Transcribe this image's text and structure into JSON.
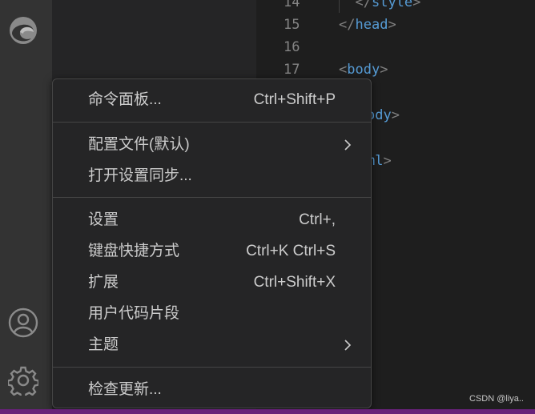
{
  "editor": {
    "lines": [
      {
        "num": "14",
        "indent": "  ",
        "open": "</",
        "tag": "style",
        "close": ">"
      },
      {
        "num": "15",
        "indent": "",
        "open": "</",
        "tag": "head",
        "close": ">"
      },
      {
        "num": "16",
        "indent": "",
        "open": "",
        "tag": "",
        "close": ""
      },
      {
        "num": "17",
        "indent": "",
        "open": "<",
        "tag": "body",
        "close": ">"
      },
      {
        "num": "",
        "indent": "",
        "open": "",
        "tag": "ody",
        "close": ">"
      },
      {
        "num": "",
        "indent": "",
        "open": "",
        "tag": "ml",
        "close": ">"
      }
    ]
  },
  "menu": {
    "command_palette": {
      "label": "命令面板...",
      "shortcut": "Ctrl+Shift+P"
    },
    "profile": {
      "label": "配置文件(默认)"
    },
    "settings_sync": {
      "label": "打开设置同步..."
    },
    "settings": {
      "label": "设置",
      "shortcut": "Ctrl+,"
    },
    "keyboard_shortcuts": {
      "label": "键盘快捷方式",
      "shortcut": "Ctrl+K Ctrl+S"
    },
    "extensions": {
      "label": "扩展",
      "shortcut": "Ctrl+Shift+X"
    },
    "user_snippets": {
      "label": "用户代码片段"
    },
    "themes": {
      "label": "主题"
    },
    "check_updates": {
      "label": "检查更新..."
    }
  },
  "watermark": "CSDN @liya..",
  "colors": {
    "activity_bar": "#333333",
    "sidebar": "#252526",
    "editor_bg": "#1e1e1e",
    "menu_bg": "#252526",
    "menu_border": "#454545",
    "tag_name": "#569cd6",
    "tag_bracket": "#808080",
    "line_number": "#858585",
    "status_strip": "#68217a"
  },
  "icons": [
    "edge-logo-icon",
    "account-icon",
    "gear-icon",
    "chevron-right-icon"
  ]
}
